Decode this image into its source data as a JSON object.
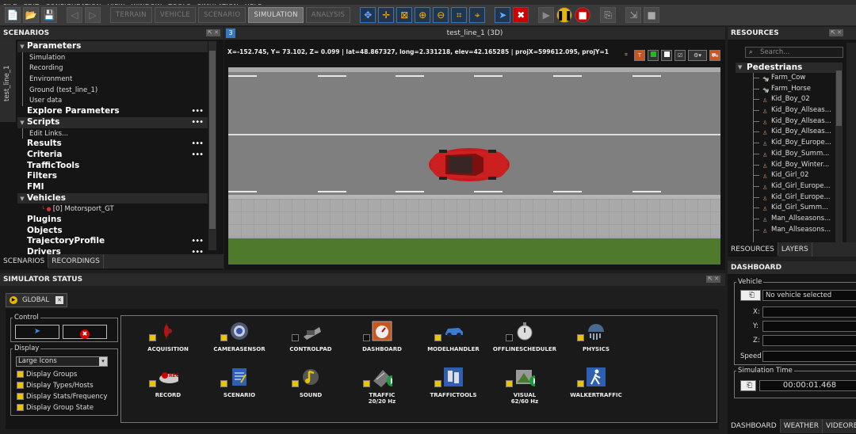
{
  "menu": [
    "FILE",
    "EDIT",
    "CONFIGURATION",
    "VIEW",
    "WINDOW",
    "TOOLS",
    "SIMULATION",
    "HELP"
  ],
  "toolbar": {
    "modes": [
      "TERRAIN",
      "VEHICLE",
      "SCENARIO",
      "SIMULATION",
      "ANALYSIS"
    ],
    "active_mode": "SIMULATION"
  },
  "scenarios": {
    "title": "SCENARIOS",
    "side_tab": "test_line_1",
    "tree": [
      {
        "label": "Parameters",
        "level": 0,
        "header": true,
        "expanded": true
      },
      {
        "label": "Simulation",
        "level": 1
      },
      {
        "label": "Recording",
        "level": 1
      },
      {
        "label": "Environment",
        "level": 1
      },
      {
        "label": "Ground (test_line_1)",
        "level": 1
      },
      {
        "label": "User data",
        "level": 1
      },
      {
        "label": "Explore Parameters",
        "level": 0,
        "dots": "•••"
      },
      {
        "label": "Scripts",
        "level": 0,
        "header": true,
        "expanded": true,
        "dots": "•••"
      },
      {
        "label": "Edit Links...",
        "level": 1
      },
      {
        "label": "Results",
        "level": 0,
        "dots": "•••"
      },
      {
        "label": "Criteria",
        "level": 0,
        "dots": "•••"
      },
      {
        "label": "TrafficTools",
        "level": 0
      },
      {
        "label": "Filters",
        "level": 0
      },
      {
        "label": "FMI",
        "level": 0
      },
      {
        "label": "Vehicles",
        "level": 0,
        "header": true,
        "expanded": true
      },
      {
        "label": "[0] Motorsport_GT",
        "level": 2
      },
      {
        "label": "Plugins",
        "level": 0
      },
      {
        "label": "Objects",
        "level": 0
      },
      {
        "label": "TrajectoryProfile",
        "level": 0,
        "dots": "•••"
      },
      {
        "label": "Drivers",
        "level": 0,
        "dots": "•••"
      }
    ],
    "tabs": [
      "SCENARIOS",
      "RECORDINGS"
    ]
  },
  "view": {
    "title": "test_line_1 (3D)",
    "coords": "X=-152.745, Y=  73.102, Z=  0.099 | lat=48.867327, long=2.331218, elev=42.165285 | projX=599612.095, projY=1"
  },
  "resources": {
    "title": "RESOURCES",
    "search_placeholder": "Search...",
    "category": "Pedestrians",
    "items": [
      "Farm_Cow",
      "Farm_Horse",
      "Kid_Boy_02",
      "Kid_Boy_Allseas...",
      "Kid_Boy_Allseas...",
      "Kid_Boy_Allseas...",
      "Kid_Boy_Europe...",
      "Kid_Boy_Summ...",
      "Kid_Boy_Winter...",
      "Kid_Girl_02",
      "Kid_Girl_Europe...",
      "Kid_Girl_Europe...",
      "Kid_Girl_Summ...",
      "Man_Allseasons...",
      "Man_Allseasons..."
    ],
    "tabs": [
      "RESOURCES",
      "LAYERS"
    ]
  },
  "dashboard": {
    "title": "DASHBOARD",
    "vehicle_legend": "Vehicle",
    "vehicle_value": "No vehicle selected",
    "x_label": "X:",
    "y_label": "Y:",
    "z_label": "Z:",
    "speed_label": "Speed",
    "sim_time_legend": "Simulation Time",
    "sim_time": "00:00:01.468",
    "tabs": [
      "DASHBOARD",
      "WEATHER",
      "VIDEORECO"
    ]
  },
  "simulator_status": {
    "title": "SIMULATOR STATUS",
    "tab": "GLOBAL",
    "control_legend": "Control",
    "display_legend": "Display",
    "display_mode": "Large Icons",
    "display_options": [
      "Display Groups",
      "Display Types/Hosts",
      "Display Stats/Frequency",
      "Display Group State"
    ],
    "plugins": [
      {
        "name": "ACQUISITION",
        "checked": true,
        "icon": "acquisition-icon"
      },
      {
        "name": "CAMERASENSOR",
        "checked": true,
        "icon": "camera-icon"
      },
      {
        "name": "CONTROLPAD",
        "checked": false,
        "icon": "controlpad-icon"
      },
      {
        "name": "DASHBOARD",
        "checked": false,
        "icon": "dashboard-icon"
      },
      {
        "name": "MODELHANDLER",
        "checked": true,
        "icon": "car-icon"
      },
      {
        "name": "OFFLINESCHEDULER",
        "checked": false,
        "icon": "stopwatch-icon"
      },
      {
        "name": "PHYSICS",
        "checked": true,
        "icon": "physics-icon"
      },
      {
        "name": "RECORD",
        "checked": true,
        "icon": "record-icon"
      },
      {
        "name": "SCENARIO",
        "checked": true,
        "icon": "scenario-icon"
      },
      {
        "name": "SOUND",
        "checked": true,
        "icon": "sound-icon"
      },
      {
        "name": "TRAFFIC",
        "sub": "20/20 Hz",
        "checked": true,
        "icon": "traffic-icon"
      },
      {
        "name": "TRAFFICTOOLS",
        "checked": true,
        "icon": "traffictools-icon"
      },
      {
        "name": "VISUAL",
        "sub": "62/60 Hz",
        "checked": true,
        "icon": "visual-icon"
      },
      {
        "name": "WALKERTRAFFIC",
        "checked": true,
        "icon": "walker-icon"
      }
    ]
  },
  "colors": {
    "accent": "#e8b500",
    "selection": "#3a73b8",
    "car": "#c41c1c",
    "grass": "#4f7a2c"
  }
}
